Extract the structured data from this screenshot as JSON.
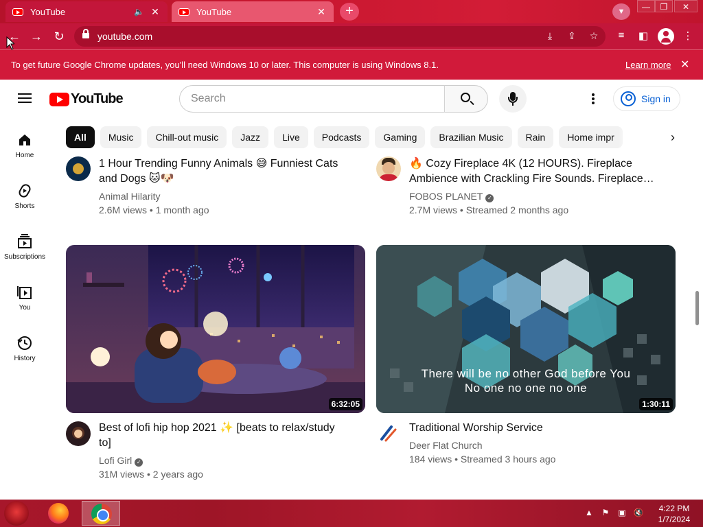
{
  "browser": {
    "tabs": [
      {
        "title": "YouTube",
        "active": true,
        "audio": true
      },
      {
        "title": "YouTube",
        "active": false,
        "audio": false
      }
    ],
    "new_tab": "+",
    "url": "youtube.com",
    "infobar": {
      "message": "To get future Google Chrome updates, you'll need Windows 10 or later. This computer is using Windows 8.1.",
      "link": "Learn more"
    }
  },
  "youtube": {
    "brand": "YouTube",
    "search_placeholder": "Search",
    "sign_in": "Sign in",
    "chips": [
      "All",
      "Music",
      "Chill-out music",
      "Jazz",
      "Live",
      "Podcasts",
      "Gaming",
      "Brazilian Music",
      "Rain",
      "Home impr"
    ],
    "rail": [
      {
        "label": "Home",
        "icon": "home-icon"
      },
      {
        "label": "Shorts",
        "icon": "shorts-icon"
      },
      {
        "label": "Subscriptions",
        "icon": "subscriptions-icon"
      },
      {
        "label": "You",
        "icon": "you-icon"
      },
      {
        "label": "History",
        "icon": "history-icon"
      }
    ],
    "videos": [
      {
        "title_line1": "1 Hour Trending Funny Animals 😅 Funniest Cats",
        "title_line2": "and Dogs 🐱🐶",
        "channel": "Animal Hilarity",
        "verified": false,
        "stats": "2.6M views • 1 month ago"
      },
      {
        "title_line1": "🔥 Cozy Fireplace 4K (12 HOURS). Fireplace",
        "title_line2": "Ambience with Crackling Fire Sounds. Fireplace…",
        "channel": "FOBOS PLANET",
        "verified": true,
        "stats": "2.7M views • Streamed 2 months ago"
      },
      {
        "title_line1": "Best of lofi hip hop 2021 ✨ [beats to relax/study",
        "title_line2": "to]",
        "channel": "Lofi Girl",
        "verified": true,
        "stats": "31M views • 2 years ago",
        "duration": "6:32:05"
      },
      {
        "title_line1": "Traditional Worship Service",
        "title_line2": "",
        "channel": "Deer Flat Church",
        "verified": false,
        "stats": "184 views • Streamed 3 hours ago",
        "duration": "1:30:11",
        "thumb_caption_line1": "There will be no other God before You",
        "thumb_caption_line2": "No one no one no one"
      }
    ]
  },
  "taskbar": {
    "time": "4:22 PM",
    "date": "1/7/2024"
  },
  "colors": {
    "chrome_theme": "#c3163a",
    "youtube_red": "#ff0000",
    "link_blue": "#065fd4"
  }
}
